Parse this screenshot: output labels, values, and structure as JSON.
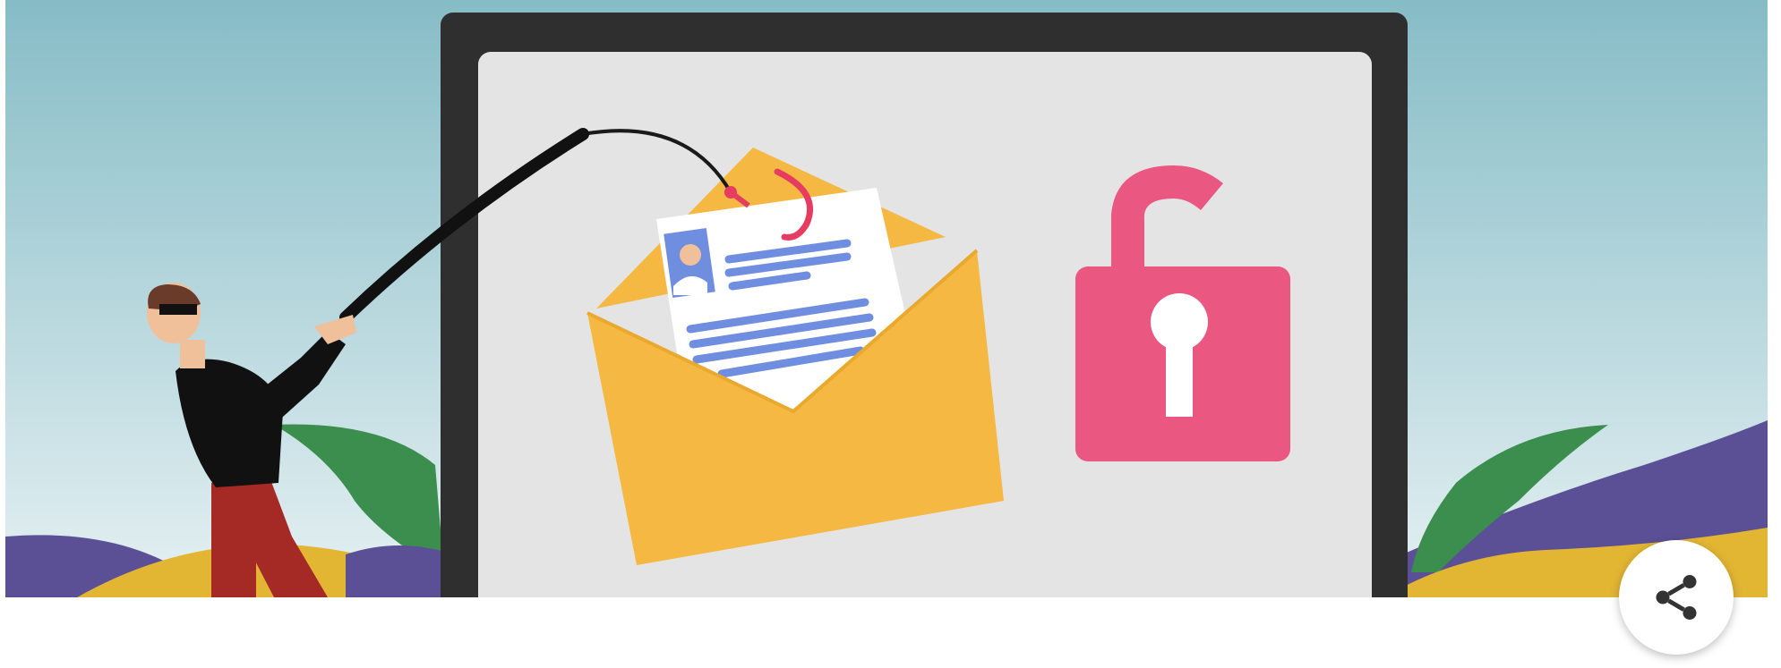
{
  "banner": {
    "illustration": "phishing-illustration",
    "colors": {
      "sky_top": "#86bcc6",
      "sky_bottom": "#e6f1f3",
      "laptop_frame": "#2f2f2f",
      "screen": "#e4e4e4",
      "envelope": "#f4b843",
      "padlock": "#ea5780",
      "hill_purple": "#5b4f96",
      "leaf_green": "#3c8e4f",
      "hill_yellow": "#e2b533",
      "id_lines": "#6f8ee0"
    }
  },
  "share": {
    "icon": "share-icon"
  },
  "article": {
    "title": ""
  }
}
